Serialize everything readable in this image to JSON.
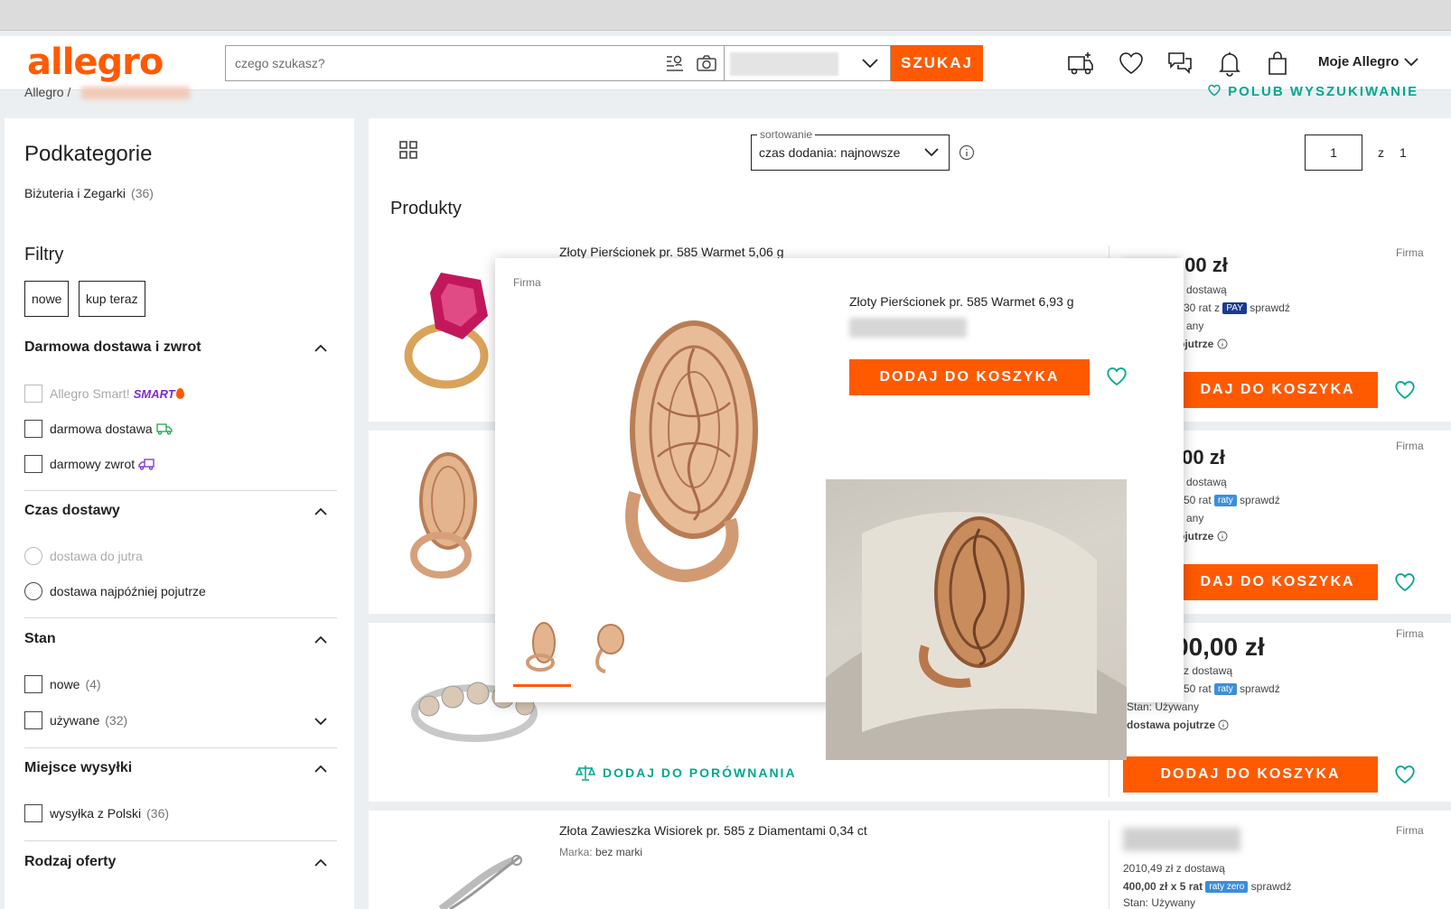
{
  "header": {
    "logo": "allegro",
    "search_placeholder": "czego szukasz?",
    "search_button": "SZUKAJ",
    "account_label": "Moje Allegro"
  },
  "breadcrumb": {
    "root": "Allegro",
    "separator": "/"
  },
  "save_search_label": "POLUB WYSZUKIWANIE",
  "sidebar": {
    "subcategories_title": "Podkategorie",
    "subcategory": {
      "label": "Biżuteria i Zegarki",
      "count": "(36)"
    },
    "filters_title": "Filtry",
    "chips": [
      "nowe",
      "kup teraz"
    ],
    "free_delivery": {
      "title": "Darmowa dostawa i zwrot",
      "options": [
        "Allegro Smart!",
        "darmowa dostawa",
        "darmowy zwrot"
      ],
      "smart_badge": "SMART"
    },
    "delivery_time": {
      "title": "Czas dostawy",
      "options": [
        "dostawa do jutra",
        "dostawa najpóźniej pojutrze"
      ]
    },
    "condition": {
      "title": "Stan",
      "options": [
        {
          "label": "nowe",
          "count": "(4)"
        },
        {
          "label": "używane",
          "count": "(32)"
        }
      ]
    },
    "ship_from": {
      "title": "Miejsce wysyłki",
      "options": [
        {
          "label": "wysyłka z Polski",
          "count": "(36)"
        }
      ]
    },
    "offer_type": {
      "title": "Rodzaj oferty"
    }
  },
  "toolbar": {
    "sort_label": "sortowanie",
    "sort_value": "czas dodania: najnowsze",
    "page_current": "1",
    "page_of": "z",
    "page_total": "1"
  },
  "products_title": "Produkty",
  "products": [
    {
      "title": "Złoty Pierścionek pr. 585 Warmet 5,06 g",
      "price_visible": ",00 zł",
      "seller": "Firma",
      "delivery_text": "dostawą",
      "installments_text": "30 rat z",
      "installments_badge": "PAY",
      "check": "sprawdź",
      "condition_text": "any",
      "delivery_date": "ojutrze",
      "cart_label": "DAJ DO KOSZYKA"
    },
    {
      "price_visible": ",00 zł",
      "seller": "Firma",
      "delivery_text": "dostawą",
      "installments_text": "50 rat",
      "installments_badge": "raty",
      "check": "sprawdź",
      "condition_text": "any",
      "delivery_date": "ojutrze",
      "cart_label": "DAJ DO KOSZYKA"
    },
    {
      "price_visible": "00,00 zł",
      "seller": "Firma",
      "delivery_text": "z dostawą",
      "installments_text": "50 rat",
      "installments_badge": "raty",
      "check": "sprawdź",
      "condition_label": "Stan:",
      "condition_value": "Używany",
      "delivery_date": "dostawa pojutrze",
      "cart_label": "DODAJ DO KOSZYKA",
      "compare_label": "DODAJ DO PORÓWNANIA"
    },
    {
      "title": "Złota Zawieszka Wisiorek pr. 585 z Diamentami 0,34 ct",
      "brand_label": "Marka:",
      "brand_value": "bez marki",
      "seller": "Firma",
      "delivery_text": "2010,49 zł z dostawą",
      "installments_text": "400,00 zł x 5 rat",
      "installments_badge": "raty zero",
      "check": "sprawdź",
      "condition_label": "Stan:",
      "condition_value": "Używany"
    }
  ],
  "popup": {
    "seller": "Firma",
    "title": "Złoty Pierścionek pr. 585 Warmet 6,93 g",
    "cart_label": "DODAJ DO KOSZYKA"
  },
  "colors": {
    "accent": "#ff5a00",
    "teal": "#00a790",
    "pay": "#1a3b8f",
    "raty": "#3b8fd9"
  }
}
